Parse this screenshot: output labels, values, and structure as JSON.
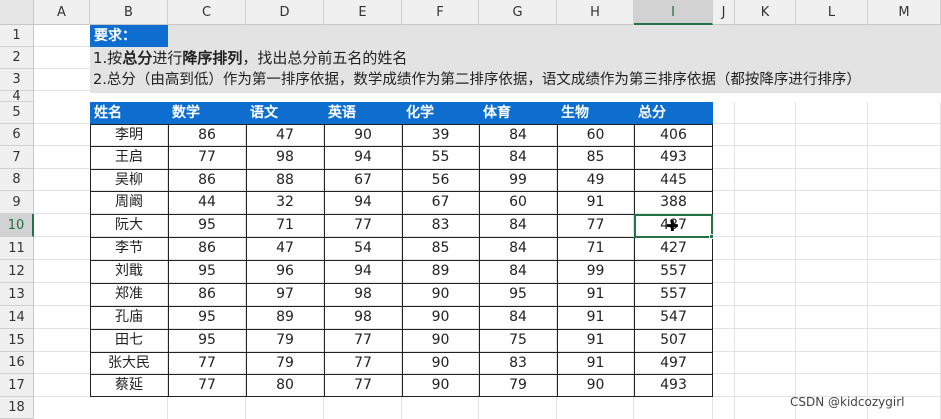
{
  "columns": [
    "A",
    "B",
    "C",
    "D",
    "E",
    "F",
    "G",
    "H",
    "I",
    "J",
    "K",
    "L",
    "M"
  ],
  "rows": [
    "1",
    "2",
    "3",
    "4",
    "5",
    "6",
    "7",
    "8",
    "9",
    "10",
    "11",
    "12",
    "13",
    "14",
    "15",
    "16",
    "17",
    "18"
  ],
  "selected_column": "I",
  "selected_row": "10",
  "requirements": {
    "title": "要求：",
    "line1_prefix": "1.按",
    "line1_bold1": "总分",
    "line1_mid": "进行",
    "line1_bold2": "降序排列",
    "line1_suffix": "，找出总分前五名的姓名",
    "line2": "2.总分（由高到低）作为第一排序依据，数学成绩作为第二排序依据，语文成绩作为第三排序依据（都按降序进行排序）"
  },
  "table": {
    "headers": [
      "姓名",
      "数学",
      "语文",
      "英语",
      "化学",
      "体育",
      "生物",
      "总分"
    ],
    "rows": [
      [
        "李明",
        "86",
        "47",
        "90",
        "39",
        "84",
        "60",
        "406"
      ],
      [
        "王启",
        "77",
        "98",
        "94",
        "55",
        "84",
        "85",
        "493"
      ],
      [
        "吴柳",
        "86",
        "88",
        "67",
        "56",
        "99",
        "49",
        "445"
      ],
      [
        "周阚",
        "44",
        "32",
        "94",
        "67",
        "60",
        "91",
        "388"
      ],
      [
        "阮大",
        "95",
        "71",
        "77",
        "83",
        "84",
        "77",
        "487"
      ],
      [
        "李节",
        "86",
        "47",
        "54",
        "85",
        "84",
        "71",
        "427"
      ],
      [
        "刘戢",
        "95",
        "96",
        "94",
        "89",
        "84",
        "99",
        "557"
      ],
      [
        "郑准",
        "86",
        "97",
        "98",
        "90",
        "95",
        "91",
        "557"
      ],
      [
        "孔庙",
        "95",
        "89",
        "98",
        "90",
        "84",
        "91",
        "547"
      ],
      [
        "田七",
        "95",
        "79",
        "77",
        "90",
        "75",
        "91",
        "507"
      ],
      [
        "张大民",
        "77",
        "79",
        "77",
        "90",
        "83",
        "91",
        "497"
      ],
      [
        "蔡延",
        "77",
        "80",
        "77",
        "90",
        "79",
        "90",
        "493"
      ]
    ]
  },
  "watermark": "CSDN @kidcozygirl",
  "colors": {
    "header_blue": "#0e6ecf",
    "excel_green": "#217346"
  }
}
